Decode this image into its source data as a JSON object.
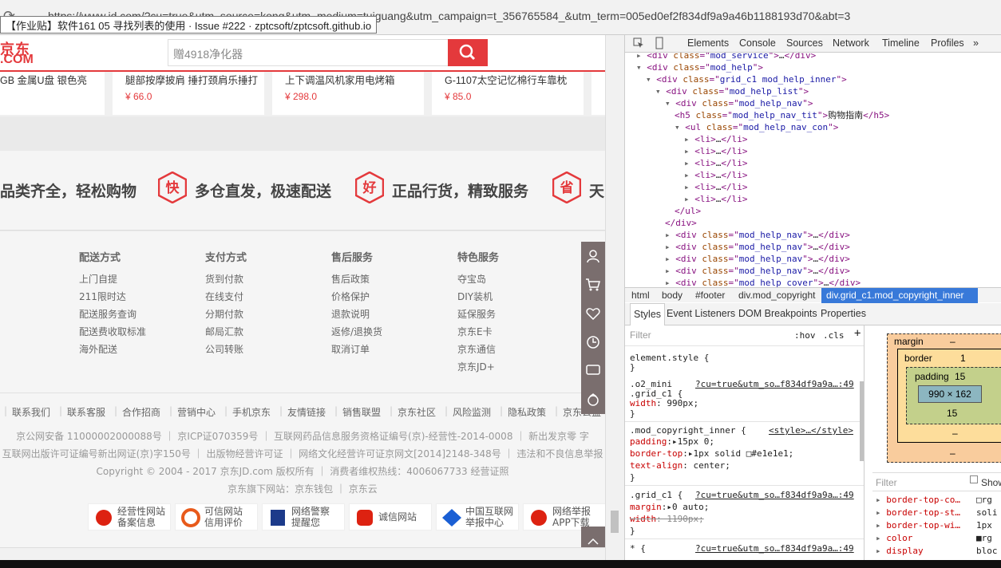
{
  "browser": {
    "url": "https://www.jd.com/?cu=true&utm_source=kong&utm_medium=tuiguang&utm_campaign=t_356765584_&utm_term=005ed0ef2f834df9a9a46b1188193d70&abt=3",
    "tooltip": "【作业贴】软件161 05 寻找列表的使用 · Issue #222 · zptcsoft/zptcsoft.github.io"
  },
  "header": {
    "logo_cn": "京东",
    "logo_en": ".COM",
    "search_placeholder": "赠4918净化器"
  },
  "products": [
    {
      "name": "GB 金属U盘 银色亮",
      "price": ""
    },
    {
      "name": "腿部按摩披肩 捶打颈肩乐捶打",
      "price": "¥ 66.0"
    },
    {
      "name": "上下调温风机家用电烤箱",
      "price": "¥ 298.0"
    },
    {
      "name": "G-1107太空记忆棉行车靠枕",
      "price": "¥ 85.0"
    }
  ],
  "promise": [
    {
      "icon": "",
      "text": "品类齐全，轻松购物"
    },
    {
      "icon": "快",
      "text": "多仓直发，极速配送"
    },
    {
      "icon": "好",
      "text": "正品行货，精致服务"
    },
    {
      "icon": "省",
      "text": "天"
    }
  ],
  "help": [
    {
      "title": "配送方式",
      "items": [
        "上门自提",
        "211限时达",
        "配送服务查询",
        "配送费收取标准",
        "海外配送"
      ]
    },
    {
      "title": "支付方式",
      "items": [
        "货到付款",
        "在线支付",
        "分期付款",
        "邮局汇款",
        "公司转账"
      ]
    },
    {
      "title": "售后服务",
      "items": [
        "售后政策",
        "价格保护",
        "退款说明",
        "返修/退换货",
        "取消订单"
      ]
    },
    {
      "title": "特色服务",
      "items": [
        "夺宝岛",
        "DIY装机",
        "延保服务",
        "京东E卡",
        "京东通信",
        "京东JD+"
      ]
    }
  ],
  "footer": {
    "links": [
      "联系我们",
      "联系客服",
      "合作招商",
      "营销中心",
      "手机京东",
      "友情链接",
      "销售联盟",
      "京东社区",
      "风险监测",
      "隐私政策",
      "京东公益"
    ],
    "line1": "京公网安备 11000002000088号 ｜ 京ICP证070359号 ｜ 互联网药品信息服务资格证编号(京)-经营性-2014-0008 ｜ 新出发京零 字",
    "line2": "互联网出版许可证编号新出网证(京)字150号 ｜ 出版物经营许可证 ｜ 网络文化经营许可证京网文[2014]2148-348号 ｜ 违法和不良信息举报",
    "line3": "Copyright © 2004 - 2017  京东JD.com 版权所有 ｜ 消费者维权热线：4006067733    经营证照",
    "line4": "京东旗下网站：京东钱包 ｜ 京东云",
    "badges": [
      {
        "text": "经营性网站\n备案信息",
        "color": "#d21"
      },
      {
        "text": "可信网站\n信用评价",
        "color": "#e85a1b"
      },
      {
        "text": "网络警察\n提醒您",
        "color": "#1c3a8a"
      },
      {
        "text": "诚信网站",
        "color": "#d21"
      },
      {
        "text": "中国互联网\n举报中心",
        "color": "#1a5fd4"
      },
      {
        "text": "网络举报\nAPP下载",
        "color": "#d21"
      }
    ]
  },
  "devtools": {
    "tabs": [
      "Elements",
      "Console",
      "Sources",
      "Network",
      "Timeline",
      "Profiles",
      "»"
    ],
    "dom": [
      {
        "i": 2,
        "t": "▸",
        "h": "<div class=\"mod_service\">…</div>"
      },
      {
        "i": 2,
        "t": "▾",
        "h": "<div class=\"mod_help\">"
      },
      {
        "i": 3,
        "t": "▾",
        "h": "<div class=\"grid_c1 mod_help_inner\">"
      },
      {
        "i": 4,
        "t": "▾",
        "h": "<div class=\"mod_help_list\">"
      },
      {
        "i": 5,
        "t": "▾",
        "h": "<div class=\"mod_help_nav\">"
      },
      {
        "i": 6,
        "t": "",
        "h": "<h5 class=\"mod_help_nav_tit\">购物指南</h5>"
      },
      {
        "i": 6,
        "t": "▾",
        "h": "<ul class=\"mod_help_nav_con\">"
      },
      {
        "i": 7,
        "t": "▸",
        "h": "<li>…</li>"
      },
      {
        "i": 7,
        "t": "▸",
        "h": "<li>…</li>"
      },
      {
        "i": 7,
        "t": "▸",
        "h": "<li>…</li>"
      },
      {
        "i": 7,
        "t": "▸",
        "h": "<li>…</li>"
      },
      {
        "i": 7,
        "t": "▸",
        "h": "<li>…</li>"
      },
      {
        "i": 7,
        "t": "▸",
        "h": "<li>…</li>"
      },
      {
        "i": 6,
        "t": "",
        "h": "</ul>"
      },
      {
        "i": 5,
        "t": "",
        "h": "</div>"
      },
      {
        "i": 5,
        "t": "▸",
        "h": "<div class=\"mod_help_nav\">…</div>"
      },
      {
        "i": 5,
        "t": "▸",
        "h": "<div class=\"mod_help_nav\">…</div>"
      },
      {
        "i": 5,
        "t": "▸",
        "h": "<div class=\"mod_help_nav\">…</div>"
      },
      {
        "i": 5,
        "t": "▸",
        "h": "<div class=\"mod_help_nav\">…</div>"
      },
      {
        "i": 5,
        "t": "▸",
        "h": "<div class=\"mod_help_cover\">…</div>"
      }
    ],
    "breadcrumbs": [
      "html",
      "body",
      "#footer",
      "div.mod_copyright",
      "div.grid_c1.mod_copyright_inner"
    ],
    "style_tabs": [
      "Styles",
      "Event Listeners",
      "DOM Breakpoints",
      "Properties"
    ],
    "filter": "Filter",
    "hov": ":hov",
    "cls": ".cls",
    "rules": [
      {
        "text": "element.style {",
        "src": ""
      },
      {
        "text": "}",
        "src": ""
      },
      {
        "text": ".o2_mini",
        "src": "?cu=true&utm_so…f834df9a9a…:49"
      },
      {
        "text": ".grid_c1 {",
        "src": ""
      },
      {
        "text": "  width: 990px;",
        "src": ""
      },
      {
        "text": "}",
        "src": ""
      },
      {
        "text": ".mod_copyright_inner {",
        "src": "<style>…</style>"
      },
      {
        "text": "  padding:▸15px 0;",
        "src": ""
      },
      {
        "text": "  border-top:▸1px solid □#e1e1e1;",
        "src": ""
      },
      {
        "text": "  text-align: center;",
        "src": ""
      },
      {
        "text": "}",
        "src": ""
      },
      {
        "text": ".grid_c1 {",
        "src": "?cu=true&utm_so…f834df9a9a…:49"
      },
      {
        "text": "  margin:▸0 auto;",
        "src": ""
      },
      {
        "text": "  width: 1190px;",
        "src": ""
      },
      {
        "text": "}",
        "src": ""
      },
      {
        "text": "* {",
        "src": "?cu=true&utm_so…f834df9a9a…:49"
      }
    ],
    "box": {
      "margin": "margin",
      "margin_val": "–",
      "border": "border",
      "border_val": "1",
      "padding": "padding",
      "padding_val": "15",
      "content": "990 × 162",
      "bottom_pad": "15",
      "bottom_border": "–",
      "bottom_margin": "–"
    },
    "computed_filter": "Filter",
    "show_all": "Show",
    "computed": [
      {
        "prop": "border-top-co…",
        "val": "□rg"
      },
      {
        "prop": "border-top-st…",
        "val": "soli"
      },
      {
        "prop": "border-top-wi…",
        "val": "1px"
      },
      {
        "prop": "color",
        "val": "■rg"
      },
      {
        "prop": "display",
        "val": "bloc"
      }
    ]
  },
  "colors": {
    "accent": "#e4393c",
    "devtools_select": "#3879d9"
  }
}
